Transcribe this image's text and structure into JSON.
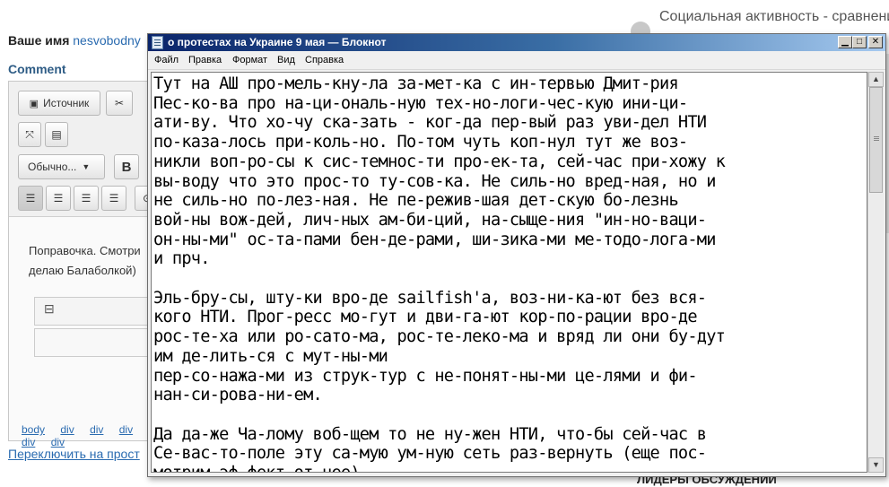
{
  "background_page": {
    "name_label": "Ваше имя",
    "user_name": "nesvobodny",
    "comment_label": "Comment",
    "toolbar": {
      "source_button": "Источник",
      "format_select": "Обычно...",
      "bold": "B"
    },
    "body_text_line1": "Поправочка. Смотри",
    "body_text_line2": "делаю Балаболкой)",
    "path_tags": [
      "body",
      "div",
      "div",
      "div",
      "div",
      "div"
    ],
    "switch_link": "Переключить на прост",
    "sidebar_title": "Социальная активность - сравнени",
    "sidebar_bottom": "ЛИДЕРЫ ОБСУЖДЕНИЙ"
  },
  "notepad": {
    "title": "о протестах на Украине 9 мая — Блокнот",
    "menu": [
      "Файл",
      "Правка",
      "Формат",
      "Вид",
      "Справка"
    ],
    "lines": [
      "Тут на АШ про-мель-кну-ла за-мет-ка с ин-тервью Дмит-рия",
      "Пес-ко-ва про на-ци-ональ-ную тех-но-логи-чес-кую ини-ци-",
      "ати-ву. Что хо-чу ска-зать - ког-да пер-вый раз уви-дел НТИ",
      "по-каза-лось при-коль-но. По-том чуть коп-нул тут же воз-",
      "никли воп-ро-сы к сис-темнос-ти про-ек-та, сей-час при-хожу к",
      "вы-воду что это прос-то ту-сов-ка. Не силь-но вред-ная, но и",
      "не силь-но по-лез-ная. Не пе-режив-шая дет-скую бо-лезнь",
      "вой-ны вож-дей, лич-ных ам-би-ций, на-сыще-ния \"ин-но-ваци-",
      "он-ны-ми\" ос-та-пами бен-де-рами, ши-зика-ми ме-тодо-лога-ми",
      "и прч.",
      "",
      "Эль-бру-сы, шту-ки вро-де sailfish'а, воз-ни-ка-ют без вся-",
      "кого НТИ. Прог-ресс мо-гут и дви-га-ют кор-по-рации вро-де",
      "рос-те-ха или ро-сато-ма, рос-те-леко-ма и вряд ли они бу-дут",
      "им де-лить-ся с мут-ны-ми",
      "пер-со-нажа-ми из струк-тур с не-понят-ны-ми це-лями и фи-",
      "нан-си-рова-ни-ем.",
      "",
      "Да да-же Ча-лому воб-щем то не ну-жен НТИ, что-бы сей-час в",
      "Се-вас-то-поле эту са-мую ум-ную сеть раз-вернуть (еще пос-",
      "мотрим эф-фект от нее)."
    ]
  }
}
